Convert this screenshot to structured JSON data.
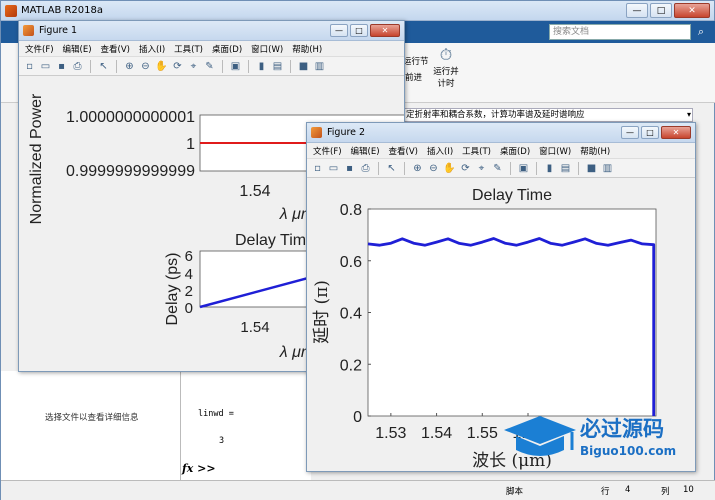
{
  "app": {
    "title": "MATLAB R2018a",
    "search_placeholder": "搜索文档",
    "toolstrip": {
      "run_section_label": "运行节",
      "advance_label": "前进",
      "run_and_time_label": "运行并计时"
    },
    "address_text": "定折射率和耦合系数，计算功率谱及延时谱响应",
    "left_panel_info": "选择文件以查看详细信息",
    "command": {
      "variable": "linwd =",
      "value": "3",
      "prompt": "fx >>"
    },
    "status": {
      "mode": "脚本",
      "row_label": "行",
      "row_value": "4",
      "col_label": "列",
      "col_value": "10"
    }
  },
  "figure1": {
    "title": "Figure 1",
    "menu": [
      "文件(F)",
      "编辑(E)",
      "查看(V)",
      "插入(I)",
      "工具(T)",
      "桌面(D)",
      "窗口(W)",
      "帮助(H)"
    ],
    "top_plot": {
      "ylabel": "Normalized Power",
      "yticks": [
        "1.0000000000001",
        "1",
        "0.9999999999999"
      ],
      "xticks": [
        "1.54"
      ],
      "xlabel": "λ μm"
    },
    "bottom_plot": {
      "title": "Delay Time",
      "ylabel": "Delay (ps)",
      "yticks": [
        "6",
        "4",
        "2",
        "0"
      ],
      "xticks": [
        "1.54"
      ],
      "xlabel": "λ μm"
    }
  },
  "figure2": {
    "title": "Figure 2",
    "menu": [
      "文件(F)",
      "编辑(E)",
      "查看(V)",
      "插入(I)",
      "工具(T)",
      "桌面(D)",
      "窗口(W)",
      "帮助(H)"
    ]
  },
  "chart_data": {
    "type": "line",
    "title": "Delay Time",
    "xlabel": "波长 (μm)",
    "ylabel": "延时 (π)",
    "xlim": [
      1.525,
      1.588
    ],
    "ylim": [
      0,
      0.8
    ],
    "xticks": [
      1.53,
      1.54,
      1.55,
      1.56
    ],
    "xtick_labels": [
      "1.53",
      "1.54",
      "1.55",
      "1.56"
    ],
    "yticks": [
      0,
      0.2,
      0.4,
      0.6,
      0.8
    ],
    "ytick_labels": [
      "0",
      "0.2",
      "0.4",
      "0.6",
      "0.8"
    ],
    "series": [
      {
        "color": "#1f1fd6",
        "x": [
          1.525,
          1.5275,
          1.53,
          1.5325,
          1.535,
          1.5375,
          1.54,
          1.5425,
          1.545,
          1.5475,
          1.55,
          1.5525,
          1.555,
          1.5575,
          1.56,
          1.5625,
          1.565,
          1.5675,
          1.57,
          1.5725,
          1.575,
          1.5775,
          1.58,
          1.5825,
          1.585,
          1.5875,
          1.5875
        ],
        "y": [
          0.665,
          0.66,
          0.668,
          0.685,
          0.668,
          0.66,
          0.672,
          0.685,
          0.667,
          0.66,
          0.672,
          0.686,
          0.668,
          0.66,
          0.672,
          0.686,
          0.667,
          0.66,
          0.672,
          0.685,
          0.667,
          0.66,
          0.67,
          0.68,
          0.665,
          0.662,
          0.0
        ]
      }
    ]
  },
  "colors": {
    "ribbon": "#1f5b9b",
    "line_blue": "#1f1fd6",
    "line_red": "#e01b1b"
  },
  "watermark": {
    "brand_cn": "必过源码",
    "brand_en": "Biguo100.com"
  }
}
